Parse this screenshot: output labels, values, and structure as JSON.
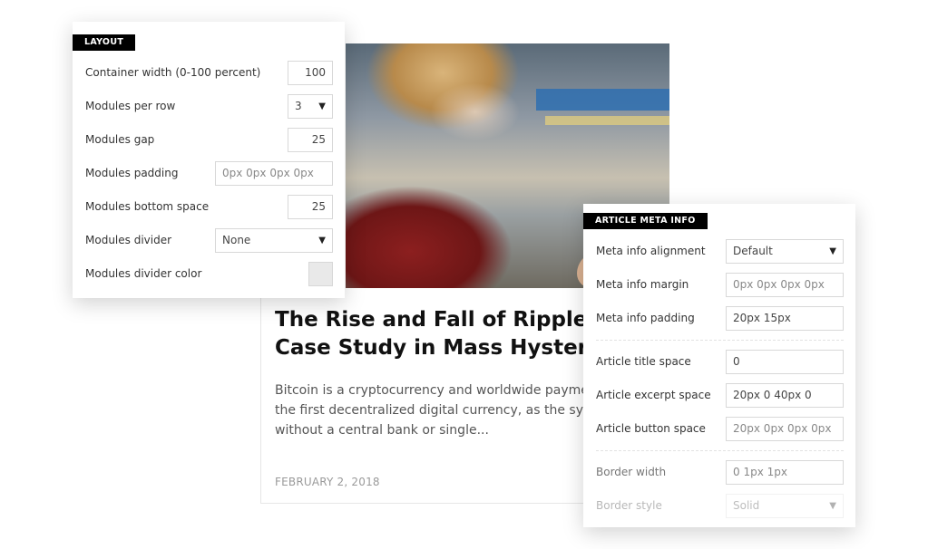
{
  "article": {
    "title": "The Rise and Fall of Ripple is a\nCase Study in Mass Hysteria",
    "excerpt": "Bitcoin is a cryptocurrency and worldwide payment s\nthe first decentralized digital currency, as the system\nwithout a central bank or single...",
    "date": "FEBRUARY 2, 2018"
  },
  "layout_panel": {
    "tag": "LAYOUT",
    "rows": [
      {
        "label": "Container width (0-100 percent)",
        "value": "100"
      },
      {
        "label": "Modules per row",
        "value": "3"
      },
      {
        "label": "Modules gap",
        "value": "25"
      },
      {
        "label": "Modules padding",
        "placeholder": "0px 0px 0px 0px"
      },
      {
        "label": "Modules bottom space",
        "value": "25"
      },
      {
        "label": "Modules divider",
        "value": "None"
      },
      {
        "label": "Modules divider color",
        "color": "#e9e9e9"
      }
    ]
  },
  "meta_panel": {
    "tag": "ARTICLE META INFO",
    "rows": [
      {
        "label": "Meta info alignment",
        "value": "Default"
      },
      {
        "label": "Meta info margin",
        "placeholder": "0px 0px 0px 0px"
      },
      {
        "label": "Meta info padding",
        "value": "20px 15px"
      },
      {
        "label": "Article title space",
        "value": "0"
      },
      {
        "label": "Article excerpt space",
        "value": "20px 0 40px 0"
      },
      {
        "label": "Article button space",
        "placeholder": "20px 0px 0px 0px"
      },
      {
        "label": "Border width",
        "placeholder": "0 1px 1px"
      },
      {
        "label": "Border style",
        "value": "Solid"
      }
    ]
  },
  "icons": {
    "dropdown": "caret-down-icon"
  },
  "colors": {
    "tag_bg": "#000000",
    "border": "#d8d8d8"
  }
}
